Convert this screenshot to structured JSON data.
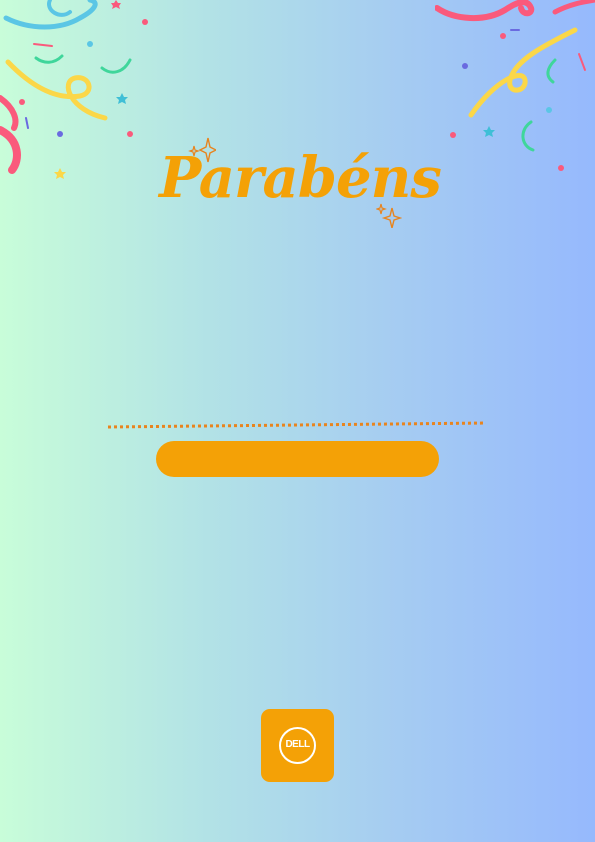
{
  "card": {
    "title": "Parabéns",
    "logo_text": "DELL",
    "colors": {
      "accent": "#f4a106",
      "dotted_line": "#e8841e",
      "gradient_start": "#c8fdd9",
      "gradient_end": "#96b9fd"
    }
  },
  "icons": [
    "confetti-left-icon",
    "confetti-right-icon",
    "sparkle-icon",
    "dell-logo-icon"
  ]
}
